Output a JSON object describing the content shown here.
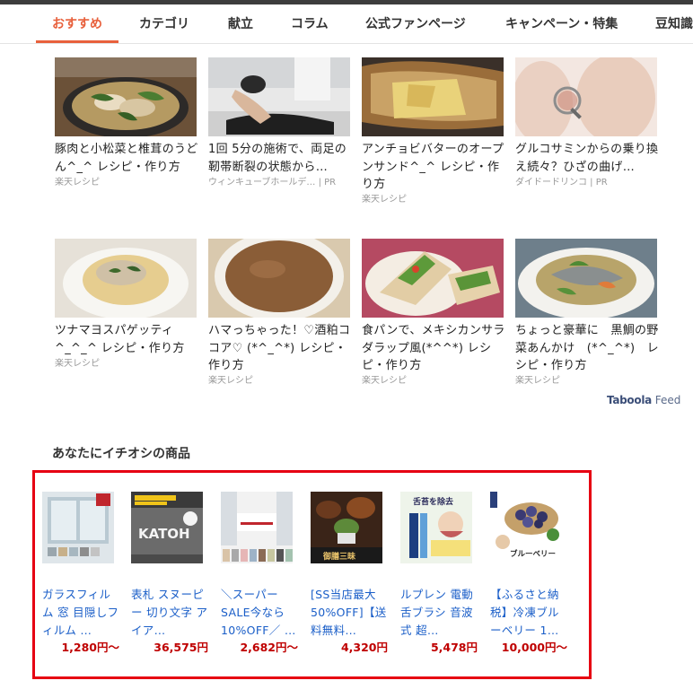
{
  "nav": {
    "tabs": [
      "おすすめ",
      "カテゴリ",
      "献立",
      "コラム",
      "公式ファンページ",
      "キャンペーン・特集",
      "豆知識"
    ],
    "active_tab": "おすすめ"
  },
  "feed": {
    "row1": [
      {
        "title": "豚肉と小松菜と椎茸のうどん^_^ レシピ・作り方",
        "source": "楽天レシピ",
        "image": "udon-bowl-photo"
      },
      {
        "title": "1回 5分の施術で、両足の靭帯断裂の状態から…",
        "source": "ウィンキューブホールデ… | PR",
        "image": "massage-treatment-photo"
      },
      {
        "title": "アンチョビバターのオープンサンド^_^ レシピ・作り方",
        "source": "楽天レシピ",
        "image": "open-sandwich-photo"
      },
      {
        "title": "グルコサミンからの乗り換え続々？ひざの曲げ…",
        "source": "ダイドードリンコ | PR",
        "image": "knee-photo"
      }
    ],
    "row2": [
      {
        "title": "ツナマヨスパゲッティ^_^_^ レシピ・作り方",
        "source": "楽天レシピ",
        "image": "pasta-photo"
      },
      {
        "title": "ハマっちゃった！♡酒粕ココア♡ (*^_^*) レシピ・作り方",
        "source": "楽天レシピ",
        "image": "cocoa-cup-photo"
      },
      {
        "title": "食パンで、メキシカンサラダラップ風(*^^*) レシピ・作り方",
        "source": "楽天レシピ",
        "image": "salad-wrap-photo"
      },
      {
        "title": "ちょっと豪華に　黒鯛の野菜あんかけ　(*^_^*)　レシピ・作り方",
        "source": "楽天レシピ",
        "image": "sea-bream-photo"
      }
    ],
    "taboola_brand": "Taboola",
    "taboola_feed": "Feed"
  },
  "recommend": {
    "section_title": "あなたにイチオシの商品",
    "products": [
      {
        "name": "ガラスフィルム 窓 目隠しフィルム …",
        "price": "1,280円〜",
        "image": "window-film-product"
      },
      {
        "name": "表札 スヌーピー 切り文字 アイア…",
        "price": "36,575円",
        "image": "katoh-nameplate-product"
      },
      {
        "name": "＼スーパーSALE今なら10%OFF／ …",
        "price": "2,682円〜",
        "image": "curtain-product"
      },
      {
        "name": "[SS当店最大50%OFF]【送料無料…",
        "price": "4,320円",
        "image": "gourmet-food-product"
      },
      {
        "name": "ルプレン 電動 舌ブラシ 音波式 超…",
        "price": "5,478円",
        "image": "tongue-brush-product"
      },
      {
        "name": "【ふるさと納税】冷凍ブルーベリー 1…",
        "price": "10,000円〜",
        "image": "blueberry-product"
      }
    ],
    "product_image_texts": [
      "KATOH",
      "舌苔を除去",
      "ブルーベリー",
      "御膳三昧"
    ]
  },
  "colors": {
    "accent": "#e8603c",
    "link": "#1a5ec8",
    "price": "#bf0000",
    "highlight_border": "#e60012"
  }
}
